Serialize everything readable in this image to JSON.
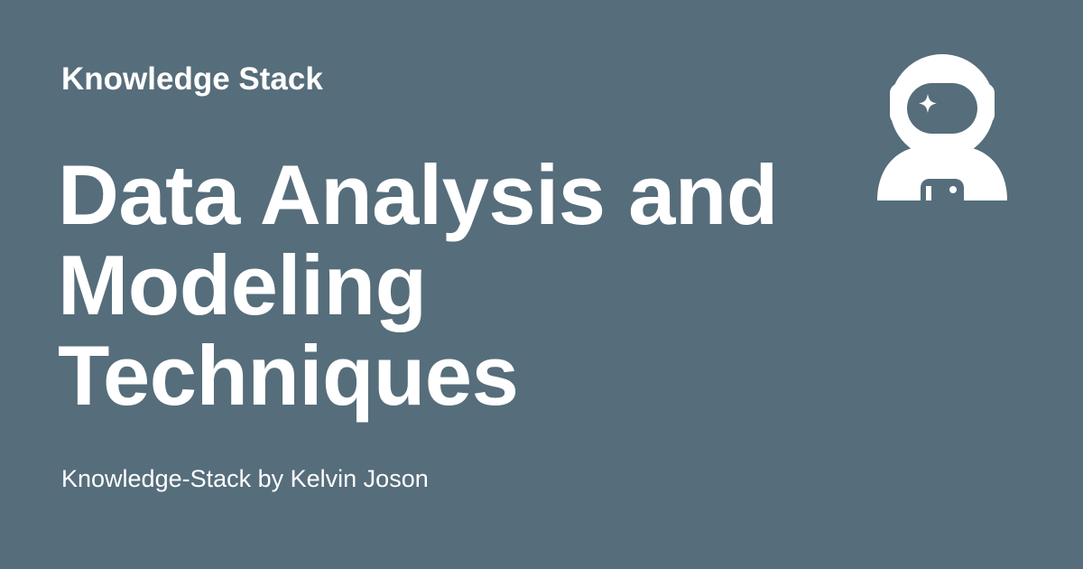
{
  "header": {
    "site_name": "Knowledge Stack"
  },
  "main": {
    "title": "Data Analysis and Modeling Techniques",
    "byline": "Knowledge-Stack by Kelvin Joson"
  },
  "logo": {
    "icon": "astronaut-icon",
    "color": "#ffffff"
  },
  "colors": {
    "background": "#566d7b",
    "text": "#ffffff"
  }
}
